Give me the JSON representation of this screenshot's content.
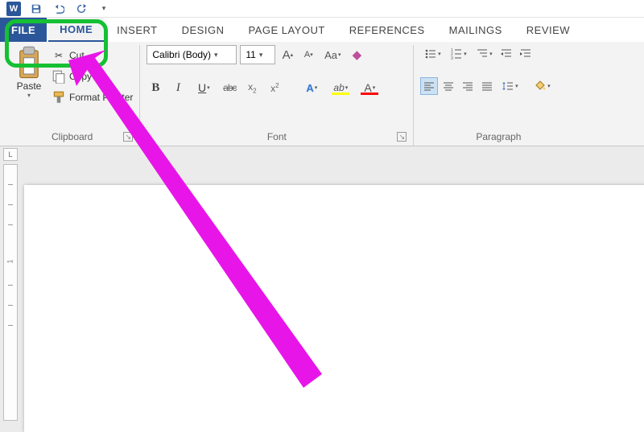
{
  "app_icon_letter": "W",
  "tabs": {
    "file": "FILE",
    "home": "HOME",
    "insert": "INSERT",
    "design": "DESIGN",
    "page_layout": "PAGE LAYOUT",
    "references": "REFERENCES",
    "mailings": "MAILINGS",
    "review": "REVIEW"
  },
  "clipboard": {
    "paste": "Paste",
    "cut": "Cut",
    "copy": "Copy",
    "format_painter": "Format Painter",
    "group_label": "Clipboard"
  },
  "font": {
    "name": "Calibri (Body)",
    "size": "11",
    "bold": "B",
    "italic": "I",
    "underline": "U",
    "strike": "abc",
    "sub": "x",
    "sup": "x",
    "a_large": "A",
    "a_small": "A",
    "aa": "Aa",
    "text_effects": "A",
    "highlight": "ab",
    "font_color": "A",
    "group_label": "Font",
    "colors": {
      "highlight": "#ffff00",
      "font": "#ff0000",
      "effects": "#3b7cd4"
    }
  },
  "paragraph": {
    "group_label": "Paragraph"
  },
  "ruler_corner": "L",
  "ruler_one": "1"
}
